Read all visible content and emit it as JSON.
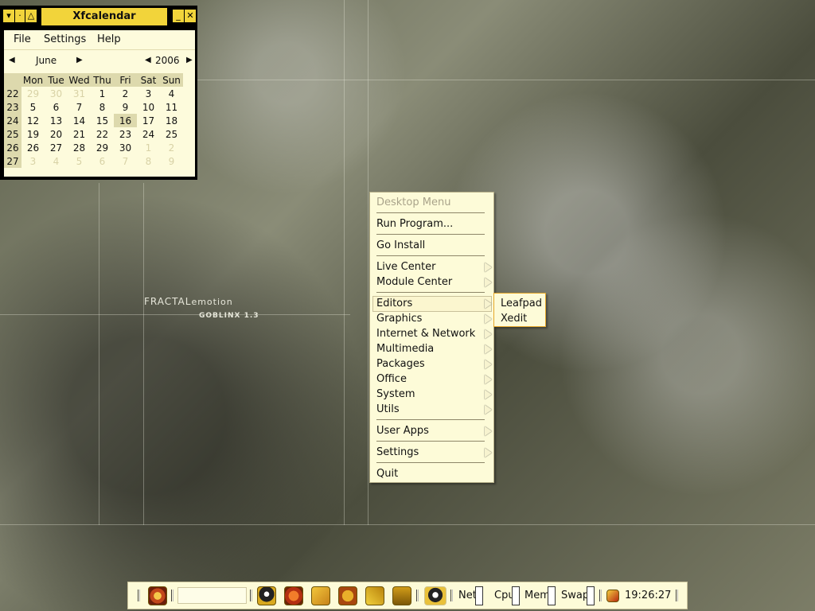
{
  "wallpaper": {
    "brand": "FRACTAL",
    "brand_suffix": "emotion",
    "distro": "GOBLINX 1.3"
  },
  "calendar": {
    "title": "Xfcalendar",
    "menu": [
      "File",
      "Settings",
      "Help"
    ],
    "month": "June",
    "year": "2006",
    "weekday_headers": [
      "Mon",
      "Tue",
      "Wed",
      "Thu",
      "Fri",
      "Sat",
      "Sun"
    ],
    "weeks": [
      {
        "week": "22",
        "days": [
          "29",
          "30",
          "31",
          "1",
          "2",
          "3",
          "4"
        ]
      },
      {
        "week": "23",
        "days": [
          "5",
          "6",
          "7",
          "8",
          "9",
          "10",
          "11"
        ]
      },
      {
        "week": "24",
        "days": [
          "12",
          "13",
          "14",
          "15",
          "16",
          "17",
          "18"
        ]
      },
      {
        "week": "25",
        "days": [
          "19",
          "20",
          "21",
          "22",
          "23",
          "24",
          "25"
        ]
      },
      {
        "week": "26",
        "days": [
          "26",
          "27",
          "28",
          "29",
          "30",
          "1",
          "2"
        ]
      },
      {
        "week": "27",
        "days": [
          "3",
          "4",
          "5",
          "6",
          "7",
          "8",
          "9"
        ]
      }
    ],
    "selected_day": "16"
  },
  "desktop_menu": {
    "header": "Desktop Menu",
    "items": [
      "Run Program...",
      "Go Install",
      "Live Center",
      "Module Center",
      "Editors",
      "Graphics",
      "Internet & Network",
      "Multimedia",
      "Packages",
      "Office",
      "System",
      "Utils",
      "User Apps",
      "Settings",
      "Quit"
    ],
    "editors_submenu": [
      "Leafpad",
      "Xedit"
    ]
  },
  "panel": {
    "labels": [
      "Net",
      "Cpu",
      "Mem",
      "Swap"
    ],
    "clock": "19:26:27"
  },
  "colors": {
    "menu_bg": "#fdfbd8",
    "title_yellow": "#f2d43a",
    "calendar_highlight": "#ddd9ad"
  }
}
